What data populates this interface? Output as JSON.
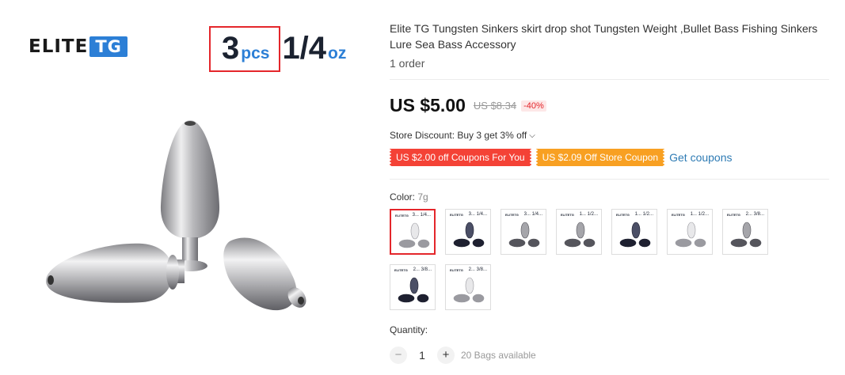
{
  "hero": {
    "brand_elite": "ELITE",
    "brand_tg": "TG",
    "pack_count": "3",
    "pack_unit": "pcs",
    "weight_value": "1/4",
    "weight_unit": "oz"
  },
  "product": {
    "title": "Elite TG Tungsten Sinkers skirt drop shot Tungsten Weight ,Bullet Bass Fishing Sinkers Lure Sea Bass Accessory",
    "orders": "1 order"
  },
  "price": {
    "current": "US $5.00",
    "original": "US $8.34",
    "discount": "-40%"
  },
  "store_discount": {
    "text": "Store Discount: Buy 3 get 3% off"
  },
  "coupons": {
    "coupon_1": "US $2.00 off Coupons For You",
    "coupon_2": "US $2.09 Off Store Coupon",
    "get_link": "Get coupons"
  },
  "color": {
    "label": "Color: ",
    "value": "7g",
    "options": [
      {
        "logo": "ELITETG",
        "text": "3... 1/4...",
        "tone": "silver",
        "selected": true
      },
      {
        "logo": "ELITETG",
        "text": "3... 1/4...",
        "tone": "dark"
      },
      {
        "logo": "ELITETG",
        "text": "3... 1/4...",
        "tone": "gray"
      },
      {
        "logo": "ELITETG",
        "text": "1... 1/2...",
        "tone": "gray"
      },
      {
        "logo": "ELITETG",
        "text": "1... 1/2...",
        "tone": "dark"
      },
      {
        "logo": "ELITETG",
        "text": "1... 1/2...",
        "tone": "silver"
      },
      {
        "logo": "ELITETG",
        "text": "2... 3/8...",
        "tone": "gray"
      },
      {
        "logo": "ELITETG",
        "text": "2... 3/8...",
        "tone": "dark"
      },
      {
        "logo": "ELITETG",
        "text": "2... 3/8...",
        "tone": "silver"
      }
    ]
  },
  "quantity": {
    "label": "Quantity:",
    "value": "1",
    "minus": "−",
    "plus": "+",
    "available": "20 Bags available"
  },
  "colors": {
    "accent_red": "#e4262b",
    "coupon_red": "#f44236",
    "coupon_orange": "#f8a022",
    "link_blue": "#2e7bb4",
    "brand_blue": "#2c7fd6"
  }
}
